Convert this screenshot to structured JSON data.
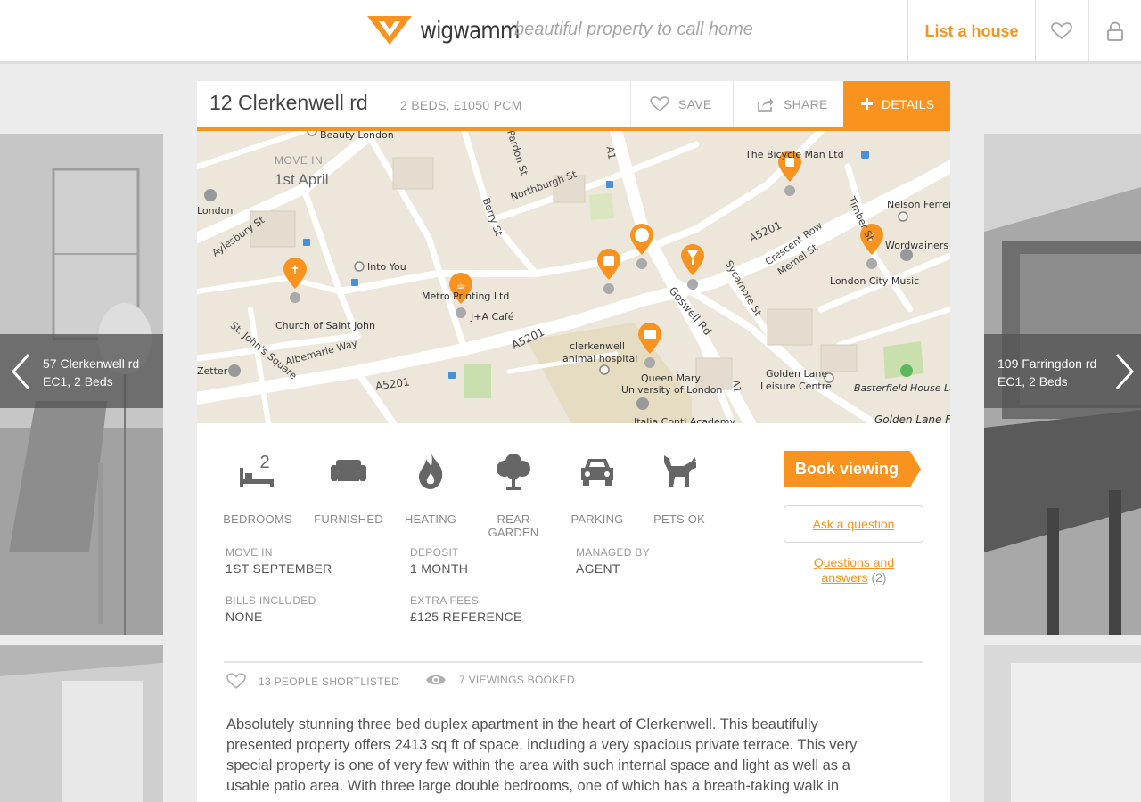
{
  "header": {
    "brand": "wigwamm",
    "tagline": "beautiful property to call home",
    "list_house": "List a house"
  },
  "colors": {
    "accent": "#f7931e",
    "map_bg": "#ede7db",
    "card_bg": "#ffffff"
  },
  "icons": {
    "header": [
      "heart-icon",
      "lock-icon"
    ],
    "nav": [
      "chevron-left-icon",
      "chevron-right-icon"
    ],
    "actions": [
      "heart-icon",
      "share-icon",
      "plus-icon"
    ],
    "features": [
      "bed-icon",
      "armchair-icon",
      "flame-icon",
      "tree-icon",
      "car-icon",
      "dog-icon"
    ],
    "stats": [
      "heart-icon",
      "eye-icon"
    ]
  },
  "prev_listing": {
    "line1": "57 Clerkenwell rd",
    "line2": "EC1, 2 Beds"
  },
  "next_listing": {
    "line1": "109 Farringdon rd",
    "line2": "EC1, 2 Beds"
  },
  "listing": {
    "address": "12 Clerkenwell rd",
    "summary": "2 BEDS, £1050 PCM",
    "save_label": "SAVE",
    "share_label": "SHARE",
    "details_label": "DETAILS"
  },
  "map": {
    "move_in_label": "MOVE IN",
    "move_in_value": "1st April",
    "places": [
      "Beauty London",
      "The Bicycle Man Ltd",
      "Nelson Ferreira",
      "Wordwainers",
      "London City Music",
      "Into You",
      "Metro Printing Ltd",
      "J+A Café",
      "Church of Saint John",
      "clerkenwell",
      "animal hospital",
      "Queen Mary,",
      "University of London",
      "Golden Lane",
      "Leisure Centre",
      "Basterfield House Lawn",
      "Zetter",
      "London",
      "Italia Conti Academy",
      "Golden Lane Fi"
    ],
    "streets": [
      "Pardon St",
      "A1",
      "Northburgh St",
      "Berry St",
      "Aylesbury St",
      "A5201",
      "Crescent Row",
      "Memel St",
      "Timber St",
      "Sycamore St",
      "Goswell Rd",
      "St. John's Square",
      "Albemarle Way",
      "A5201",
      "A5201",
      "A1"
    ]
  },
  "features": [
    {
      "label": "BEDROOMS",
      "count": "2"
    },
    {
      "label": "FURNISHED"
    },
    {
      "label": "HEATING"
    },
    {
      "label": "REAR GARDEN"
    },
    {
      "label": "PARKING"
    },
    {
      "label": "PETS OK"
    }
  ],
  "actions": {
    "book": "Book viewing",
    "ask": "Ask a question",
    "qa_label": "Questions and answers",
    "qa_count": "(2)"
  },
  "info": {
    "move_in_label": "MOVE IN",
    "move_in_value": "1ST SEPTEMBER",
    "deposit_label": "DEPOSIT",
    "deposit_value": "1 MONTH",
    "managed_label": "MANAGED BY",
    "managed_value": "AGENT",
    "bills_label": "BILLS INCLUDED",
    "bills_value": "NONE",
    "fees_label": "EXTRA FEES",
    "fees_value": "£125 REFERENCE"
  },
  "stats": {
    "shortlisted": "13 PEOPLE SHORTLISTED",
    "viewings": "7 VIEWINGS BOOKED"
  },
  "description": "Absolutely stunning three bed duplex apartment in the heart of Clerkenwell. This beautifully presented property offers 2413 sq ft of space, including a very spacious private terrace. This very special property is one of very few within the area with such internal space and light as well as a usable patio area. With three large double bedrooms, one of which has a breath-taking walk in"
}
